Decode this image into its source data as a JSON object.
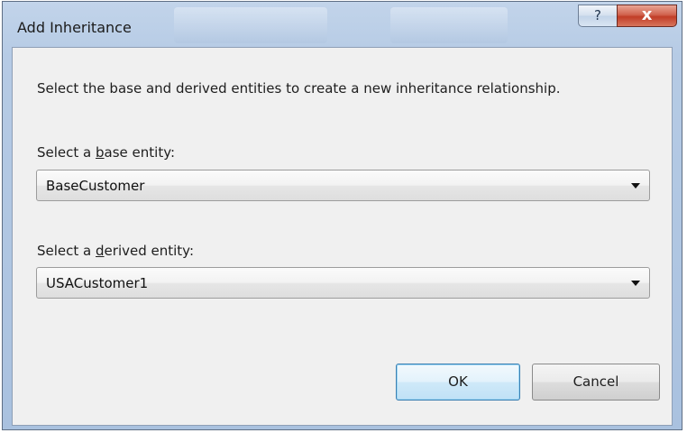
{
  "window": {
    "title": "Add Inheritance",
    "help_glyph": "?",
    "close_glyph": "x"
  },
  "dialog": {
    "instructions": "Select the base and derived entities to create a new inheritance relationship.",
    "base": {
      "label_prefix": "Select a ",
      "label_access_key": "b",
      "label_suffix": "ase entity:",
      "selected_value": "BaseCustomer"
    },
    "derived": {
      "label_prefix": "Select a ",
      "label_access_key": "d",
      "label_suffix": "erived entity:",
      "selected_value": "USACustomer1"
    },
    "buttons": {
      "ok_label": "OK",
      "cancel_label": "Cancel"
    }
  },
  "colors": {
    "title_bar": "#b6cbe5",
    "client_bg": "#f0f0f0",
    "close_button": "#c13d27",
    "default_button_border": "#3c7fb1"
  }
}
